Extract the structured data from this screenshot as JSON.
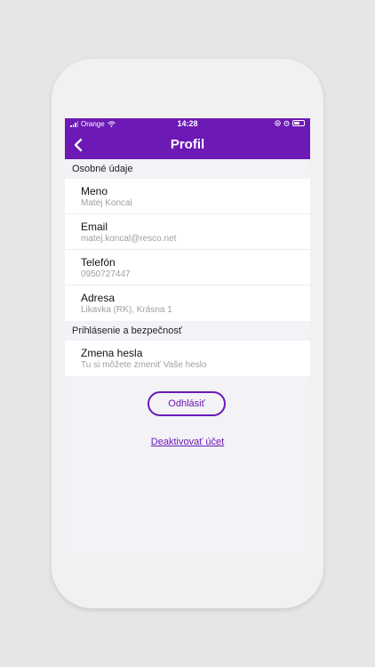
{
  "status_bar": {
    "carrier": "Orange",
    "time": "14:28",
    "battery_level": 0.6
  },
  "nav": {
    "title": "Profil",
    "back_icon": "chevron-left-icon"
  },
  "sections": [
    {
      "header": "Osobné údaje",
      "rows": [
        {
          "label": "Meno",
          "value": "Matej Koncal"
        },
        {
          "label": "Email",
          "value": "matej.koncal@resco.net"
        },
        {
          "label": "Telefón",
          "value": "0950727447"
        },
        {
          "label": "Adresa",
          "value": "Likavka (RK), Krásna 1"
        }
      ]
    },
    {
      "header": "Prihlásenie a bezpečnosť",
      "rows": [
        {
          "label": "Zmena hesla",
          "value": "Tu si môžete zmeniť Vaše heslo"
        }
      ]
    }
  ],
  "actions": {
    "logout": "Odhlásiť",
    "deactivate": "Deaktivovať účet"
  },
  "colors": {
    "accent": "#6c19b5",
    "background": "#f2f2f7"
  }
}
